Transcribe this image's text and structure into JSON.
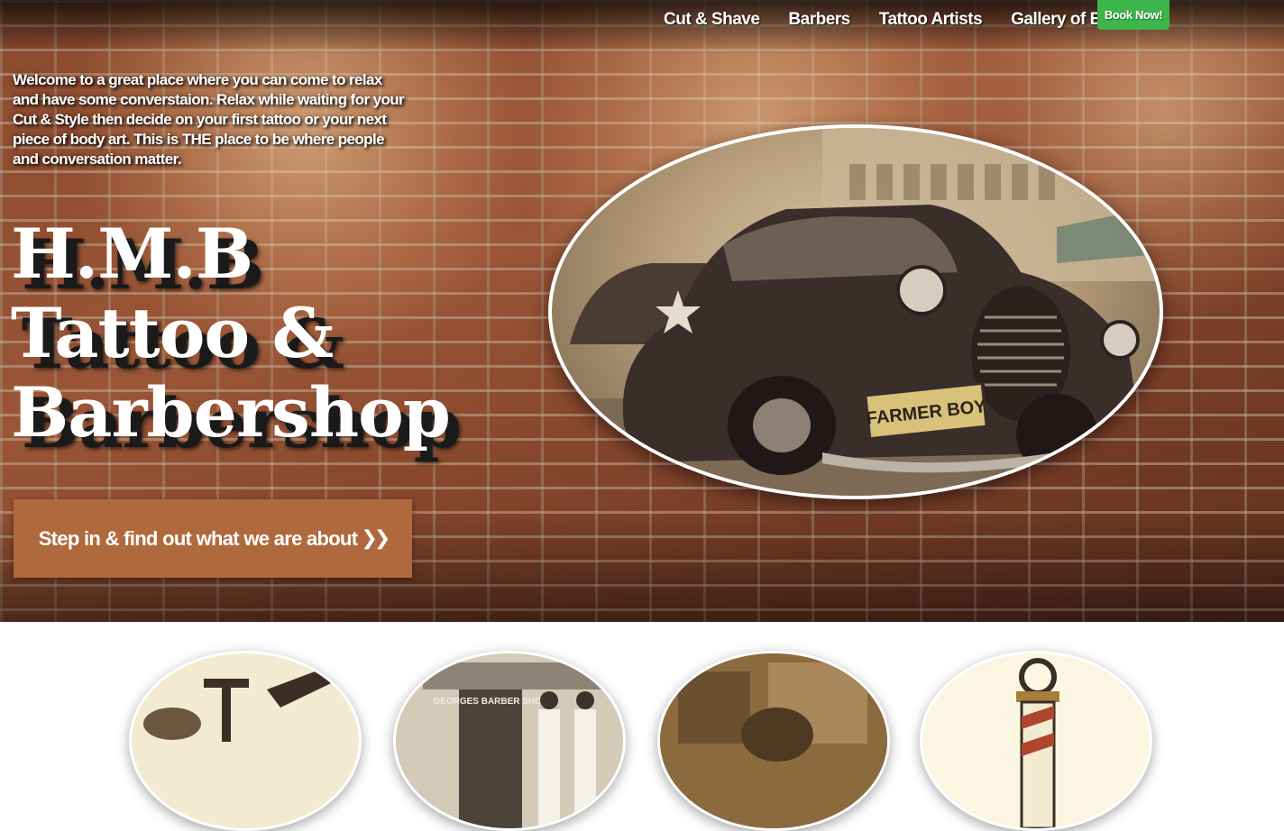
{
  "nav": {
    "items": [
      {
        "label": "Cut & Shave"
      },
      {
        "label": "Barbers"
      },
      {
        "label": "Tattoo Artists"
      },
      {
        "label": "Gallery of Body Art"
      }
    ],
    "book_label": "Book Now!"
  },
  "hero": {
    "welcome_text": "Welcome to a great place where you can come to relax and have some converstaion. Relax while waiting for your Cut & Style then decide on your first tattoo or your next piece of body art. This is THE place to be where people and conversation matter.",
    "title_lines": [
      "H.M.B",
      "Tattoo &",
      "Barbershop"
    ],
    "cta_label": "Step in & find out what we are about",
    "cta_chevron": "❯❯",
    "photo_plate": "FARMER BOY"
  },
  "features": {
    "circles": [
      {
        "icon": "razor-brush-icon"
      },
      {
        "icon": "barber-shop-photo"
      },
      {
        "icon": "vintage-street-photo"
      },
      {
        "icon": "barber-pole-icon"
      }
    ],
    "shop_sign": "GEORGES BARBER SHOP"
  },
  "colors": {
    "cta": "#b0693c",
    "book_button": "#3cb54a",
    "brick": "#8a4a2e"
  }
}
